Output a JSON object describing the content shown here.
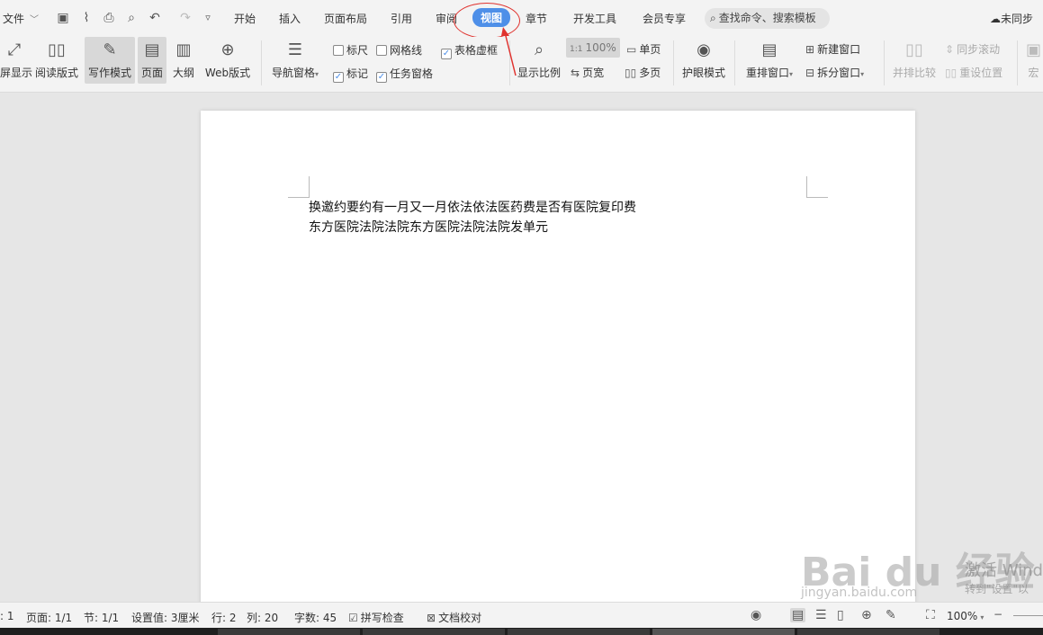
{
  "menu": {
    "file_label": "文件",
    "tabs": [
      {
        "label": "开始"
      },
      {
        "label": "插入"
      },
      {
        "label": "页面布局"
      },
      {
        "label": "引用"
      },
      {
        "label": "审阅"
      },
      {
        "label": "视图",
        "active": true
      },
      {
        "label": "章节"
      },
      {
        "label": "开发工具"
      },
      {
        "label": "会员专享"
      }
    ],
    "search_placeholder": "查找命令、搜索模板",
    "sync_label": "未同步"
  },
  "ribbon": {
    "fullscreen_label": "屏显示",
    "read_mode_label": "阅读版式",
    "write_mode_label": "写作模式",
    "page_label": "页面",
    "outline_label": "大纲",
    "web_label": "Web版式",
    "nav_pane_label": "导航窗格",
    "ruler_label": "标尺",
    "gridlines_label": "网格线",
    "table_gridlines_label": "表格虚框",
    "markup_label": "标记",
    "task_pane_label": "任务窗格",
    "zoom_label": "显示比例",
    "zoom_100_label": "100%",
    "page_width_label": "页宽",
    "single_page_label": "单页",
    "multi_page_label": "多页",
    "eye_mode_label": "护眼模式",
    "arrange_label": "重排窗口",
    "new_window_label": "新建窗口",
    "split_window_label": "拆分窗口",
    "side_by_side_label": "并排比较",
    "sync_scroll_label": "同步滚动",
    "reset_pos_label": "重设位置",
    "macro_label": "宏",
    "checkbox_state": {
      "ruler": false,
      "gridlines": false,
      "table_gridlines": true,
      "markup": true,
      "task_pane": true
    }
  },
  "document": {
    "lines": [
      "换邀约要约有一月又一月依法依法医药费是否有医院复印费",
      "东方医院法院法院东方医院法院法院发单元"
    ]
  },
  "statusbar": {
    "page_num": ": 1",
    "page": "页面: 1/1",
    "section": "节: 1/1",
    "setting": "设置值: 3厘米",
    "row": "行: 2",
    "col": "列: 20",
    "words": "字数: 45",
    "spell_check": "拼写检查",
    "doc_proof": "文档校对",
    "zoom": "100%"
  },
  "overlay": {
    "watermark": "Bai du 经验",
    "watermark_sub": "jingyan.baidu.com",
    "activate_title": "激活 Wind",
    "activate_sub": "转到\"设置\"以"
  },
  "colors": {
    "accent": "#4e8fe8",
    "annotation": "#e0322e"
  }
}
